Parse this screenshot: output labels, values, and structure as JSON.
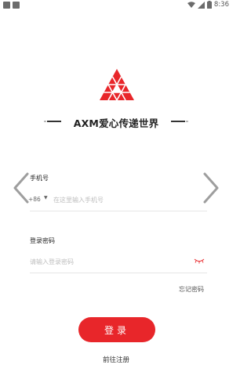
{
  "status_bar": {
    "time": "8:36",
    "icons": [
      "notification-icon",
      "warning-icon",
      "wifi-icon",
      "signal-icon",
      "battery-icon"
    ]
  },
  "header": {
    "title": "AXM爱心传递世界"
  },
  "form": {
    "phone_label": "手机号",
    "country_code": "+86",
    "phone_placeholder": "在这里输入手机号",
    "password_label": "登录密码",
    "password_placeholder": "请输入登录密码",
    "forgot_link": "忘记密码"
  },
  "actions": {
    "login_label": "登录",
    "register_link": "前往注册"
  },
  "colors": {
    "accent": "#e8262a",
    "text": "#222222",
    "placeholder": "#bdbdbd"
  }
}
